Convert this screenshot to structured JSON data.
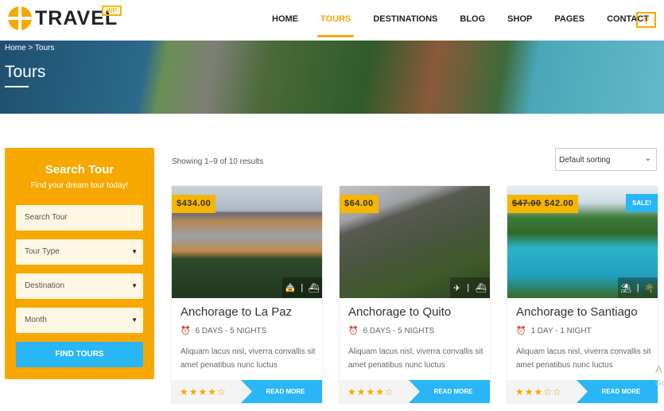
{
  "header": {
    "logo": "TRAVEL",
    "logo_badge": "WP",
    "nav": [
      "HOME",
      "TOURS",
      "DESTINATIONS",
      "BLOG",
      "SHOP",
      "PAGES",
      "CONTACT"
    ],
    "active_nav": "TOURS",
    "search_icon": "search-icon"
  },
  "hero": {
    "breadcrumb": "Home > Tours",
    "title": "Tours"
  },
  "sidebar": {
    "title": "Search Tour",
    "subtitle": "Find your dream tour today!",
    "search_placeholder": "Search Tour",
    "tour_type": "Tour Type",
    "destination": "Destination",
    "month": "Month",
    "button": "FIND TOURS"
  },
  "results": {
    "showing": "Showing 1–9 of 10 results",
    "sort": "Default sorting"
  },
  "cards": [
    {
      "price": "$434.00",
      "old_price": "",
      "sale": "",
      "title": "Anchorage to La Paz",
      "duration": "6 DAYS - 5 NIGHTS",
      "desc": "Aliquam lacus nisl, viverra convallis sit amet penatibus nunc luctus",
      "stars": "★★★★☆",
      "rating": 4,
      "icons": [
        "car-icon",
        "boat-icon"
      ],
      "button": "READ MORE"
    },
    {
      "price": "$64.00",
      "old_price": "",
      "sale": "",
      "title": "Anchorage to Quito",
      "duration": "6 DAYS - 5 NIGHTS",
      "desc": "Aliquam lacus nisl, viverra convallis sit amet penatibus nunc luctus",
      "stars": "★★★★☆",
      "rating": 4,
      "icons": [
        "plane-icon",
        "boat-icon"
      ],
      "button": "READ MORE"
    },
    {
      "price": "$42.00",
      "old_price": "$47.00",
      "sale": "SALE!",
      "title": "Anchorage to Santiago",
      "duration": "1 DAY - 1 NIGHT",
      "desc": "Aliquam lacus nisl, viverra convallis sit amet penatibus nunc luctus",
      "stars": "★★★☆☆",
      "rating": 3,
      "icons": [
        "beach-icon",
        "palm-icon"
      ],
      "button": "READ MORE"
    }
  ],
  "watermark": {
    "line1": "A",
    "line2": "Go"
  },
  "colors": {
    "accent": "#f7a800",
    "blue": "#29b6f6"
  }
}
